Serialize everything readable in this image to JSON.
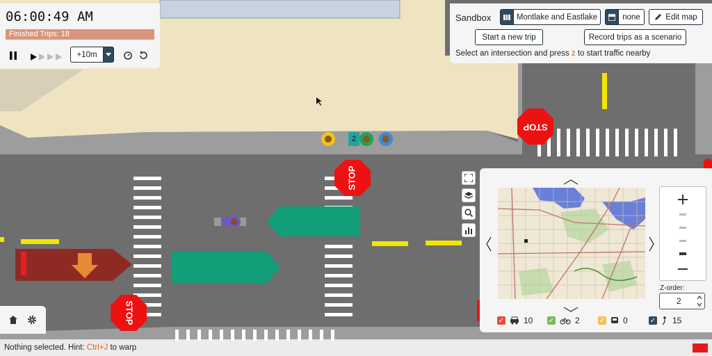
{
  "clock": {
    "time": "06:00:49 AM"
  },
  "finished_trips": {
    "label": "Finished Trips: 18",
    "fraction": 1.0
  },
  "speed": {
    "step_label": "+10m"
  },
  "sandbox": {
    "title": "Sandbox",
    "map_name": "Montlake and Eastlake",
    "scenario": "none",
    "edit_map": "Edit map",
    "start_trip": "Start a new trip",
    "record_trips": "Record trips as a scenario",
    "hint_before": "Select an intersection and press ",
    "hint_key": "z",
    "hint_after": " to start traffic nearby"
  },
  "minimap": {
    "zorder_label": "Z-order:",
    "zorder_value": "2",
    "legend": [
      {
        "name": "cars",
        "icon": "car-icon",
        "count": "10",
        "color": "#e64b3c"
      },
      {
        "name": "bikes",
        "icon": "bike-icon",
        "count": "2",
        "color": "#7cbb5b"
      },
      {
        "name": "buses",
        "icon": "bus-icon",
        "count": "0",
        "color": "#f4c15b"
      },
      {
        "name": "pedestrians",
        "icon": "pedestrian-icon",
        "count": "15",
        "color": "#2f4b60"
      }
    ]
  },
  "map": {
    "stop_text": "STOP",
    "ped_group_count": "2"
  },
  "status": {
    "text": "Nothing selected. Hint: ",
    "hotkey": "Ctrl+J",
    "after": " to warp"
  }
}
